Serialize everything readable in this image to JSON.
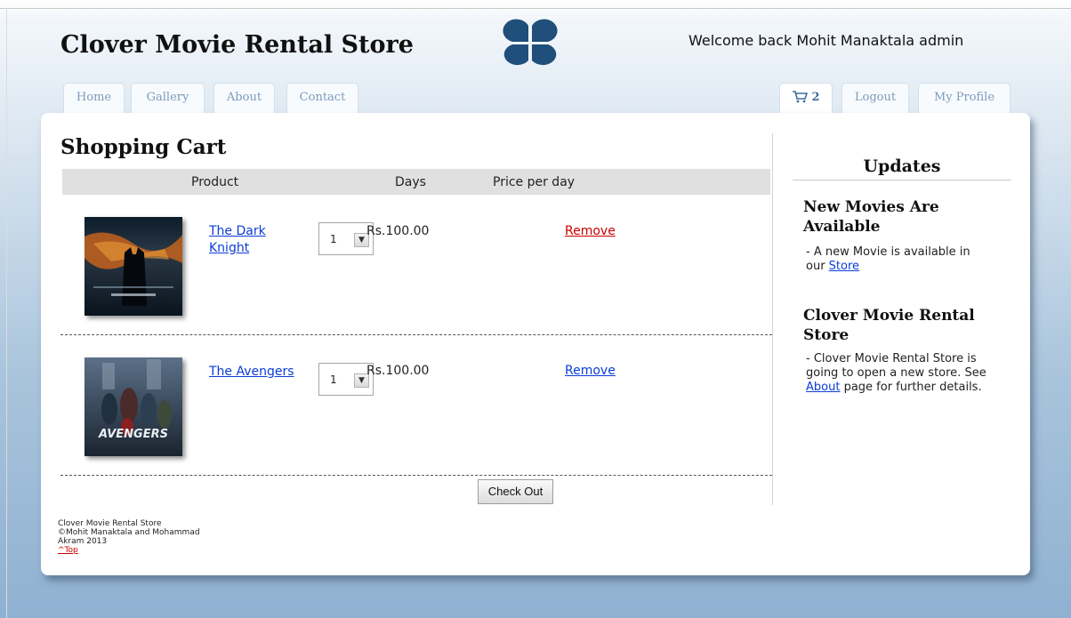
{
  "header": {
    "site_title": "Clover Movie Rental Store",
    "welcome": "Welcome back Mohit Manaktala admin",
    "logo_icon": "clover-icon",
    "brand_color": "#1f4f7a"
  },
  "nav": {
    "left_tabs": [
      "Home",
      "Gallery",
      "About",
      "Contact"
    ],
    "cart_count": "2",
    "cart_icon": "shopping-cart-icon",
    "right_tabs": [
      "Logout",
      "My Profile"
    ]
  },
  "cart": {
    "title": "Shopping Cart",
    "columns": [
      "Product",
      "Days",
      "Price per day"
    ],
    "items": [
      {
        "title": "The Dark Knight",
        "days": "1",
        "price": "Rs.100.00",
        "remove": "Remove",
        "poster_icon": "dark-knight-poster"
      },
      {
        "title": "The Avengers",
        "days": "1",
        "price": "Rs.100.00",
        "remove": "Remove",
        "poster_icon": "avengers-poster",
        "poster_text": "AVENGERS"
      }
    ],
    "checkout": "Check Out",
    "remove_colors": {
      "active": "#cc0000",
      "default": "#0b3cd8"
    }
  },
  "updates": {
    "title": "Updates",
    "news": [
      {
        "title": "New Movies Are Available",
        "text": "- A new Movie is available in our ",
        "link": "Store"
      },
      {
        "title": "Clover Movie Rental Store",
        "text_before": "- Clover Movie Rental Store is going to open a new store. See ",
        "link": "About",
        "text_after": " page for further details."
      }
    ]
  },
  "footer": {
    "line1": "Clover Movie Rental Store",
    "line2": "©Mohit Manaktala and Mohammad",
    "line3": "Akram 2013",
    "top_link": "^Top"
  }
}
